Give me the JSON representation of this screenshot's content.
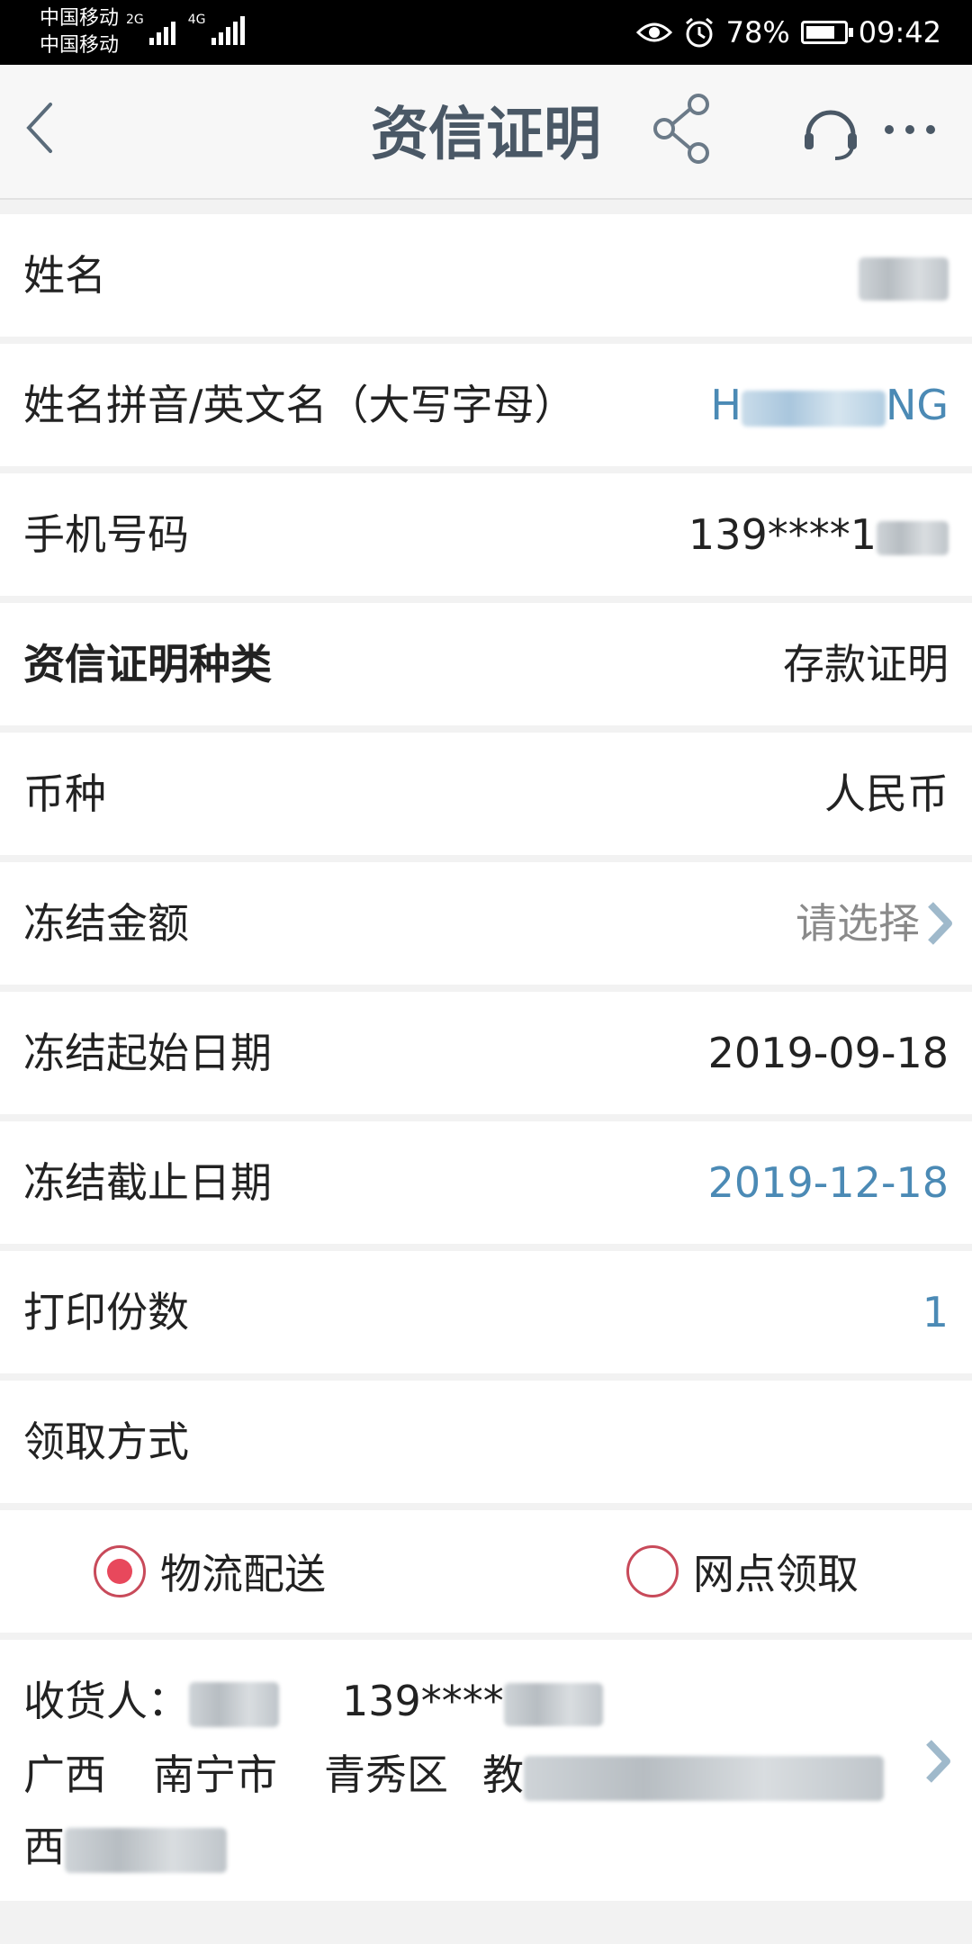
{
  "status_bar": {
    "carrier_1": "中国移动",
    "carrier_2": "中国移动",
    "net_1": "2G",
    "net_2": "4G",
    "battery": "78%",
    "battery_level": 0.78,
    "time": "09:42"
  },
  "nav": {
    "title": "资信证明"
  },
  "rows": {
    "name_label": "姓名",
    "pinyin_label": "姓名拼音/英文名（大写字母）",
    "pinyin_value_start": "H",
    "pinyin_value_end": "NG",
    "phone_label": "手机号码",
    "phone_value": "139****1",
    "type_label": "资信证明种类",
    "type_value": "存款证明",
    "currency_label": "币种",
    "currency_value": "人民币",
    "amount_label": "冻结金额",
    "amount_value": "请选择",
    "start_label": "冻结起始日期",
    "start_value": "2019-09-18",
    "end_label": "冻结截止日期",
    "end_value": "2019-12-18",
    "copies_label": "打印份数",
    "copies_value": "1",
    "pickup_label": "领取方式"
  },
  "pickup": {
    "option_1": "物流配送",
    "option_2": "网点领取",
    "selected": "物流配送"
  },
  "address": {
    "receiver_label": "收货人：",
    "receiver_phone": "139****",
    "province": "广西",
    "city": "南宁市",
    "district": "青秀区",
    "street_start": "教",
    "line3_start": "西"
  },
  "colors": {
    "accent_blue": "#4b8ab5",
    "radio_red": "#e8485c",
    "title_color": "#4a5866"
  }
}
